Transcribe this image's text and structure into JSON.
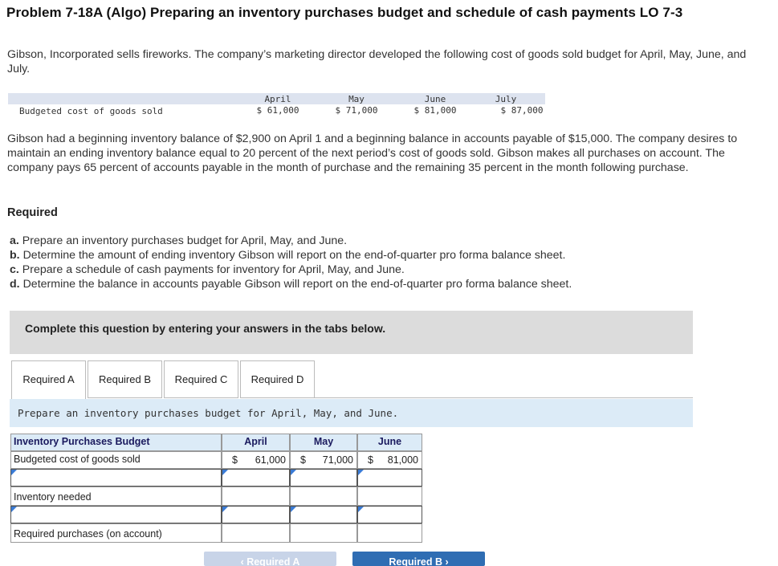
{
  "title": "Problem 7-18A (Algo) Preparing an inventory purchases budget and schedule of cash payments LO 7-3",
  "intro": "Gibson, Incorporated sells fireworks. The company’s marketing director developed the following cost of goods sold budget for April, May, June, and July.",
  "cogs_table": {
    "row_label": "Budgeted cost of goods sold",
    "months": [
      "April",
      "May",
      "June",
      "July"
    ],
    "values": [
      "$ 61,000",
      "$ 71,000",
      "$ 81,000",
      "$ 87,000"
    ]
  },
  "details": "Gibson had a beginning inventory balance of $2,900 on April 1 and a beginning balance in accounts payable of $15,000. The company desires to maintain an ending inventory balance equal to 20 percent of the next period’s cost of goods sold. Gibson makes all purchases on account. The company pays 65 percent of accounts payable in the month of purchase and the remaining 35 percent in the month following purchase.",
  "required_heading": "Required",
  "requirements": [
    {
      "letter": "a.",
      "text": "Prepare an inventory purchases budget for April, May, and June."
    },
    {
      "letter": "b.",
      "text": "Determine the amount of ending inventory Gibson will report on the end-of-quarter pro forma balance sheet."
    },
    {
      "letter": "c.",
      "text": "Prepare a schedule of cash payments for inventory for April, May, and June."
    },
    {
      "letter": "d.",
      "text": "Determine the balance in accounts payable Gibson will report on the end-of-quarter pro forma balance sheet."
    }
  ],
  "complete_prompt": "Complete this question by entering your answers in the tabs below.",
  "tabs": [
    "Required A",
    "Required B",
    "Required C",
    "Required D"
  ],
  "active_tab": "Required A",
  "instruction": "Prepare an inventory purchases budget for April, May, and June.",
  "budget": {
    "header": "Inventory Purchases Budget",
    "months": [
      "April",
      "May",
      "June"
    ],
    "row_cogs": {
      "label": "Budgeted cost of goods sold",
      "currency": [
        "$",
        "$",
        "$"
      ],
      "values": [
        "61,000",
        "71,000",
        "81,000"
      ]
    },
    "row_input1": {
      "label": "",
      "values": [
        "",
        "",
        ""
      ]
    },
    "row_inventory_needed": {
      "label": "Inventory needed"
    },
    "row_input2": {
      "label": "",
      "values": [
        "",
        "",
        ""
      ]
    },
    "row_required_purchases": {
      "label": "Required purchases (on account)"
    }
  },
  "nav": {
    "prev_label": "‹  Required A",
    "next_label": "Required B  ›"
  },
  "colors": {
    "header_band": "#dde3ef",
    "instruction_bg": "#dcebf7",
    "next_button": "#2f6db3",
    "prev_button": "#c8d4e8"
  }
}
